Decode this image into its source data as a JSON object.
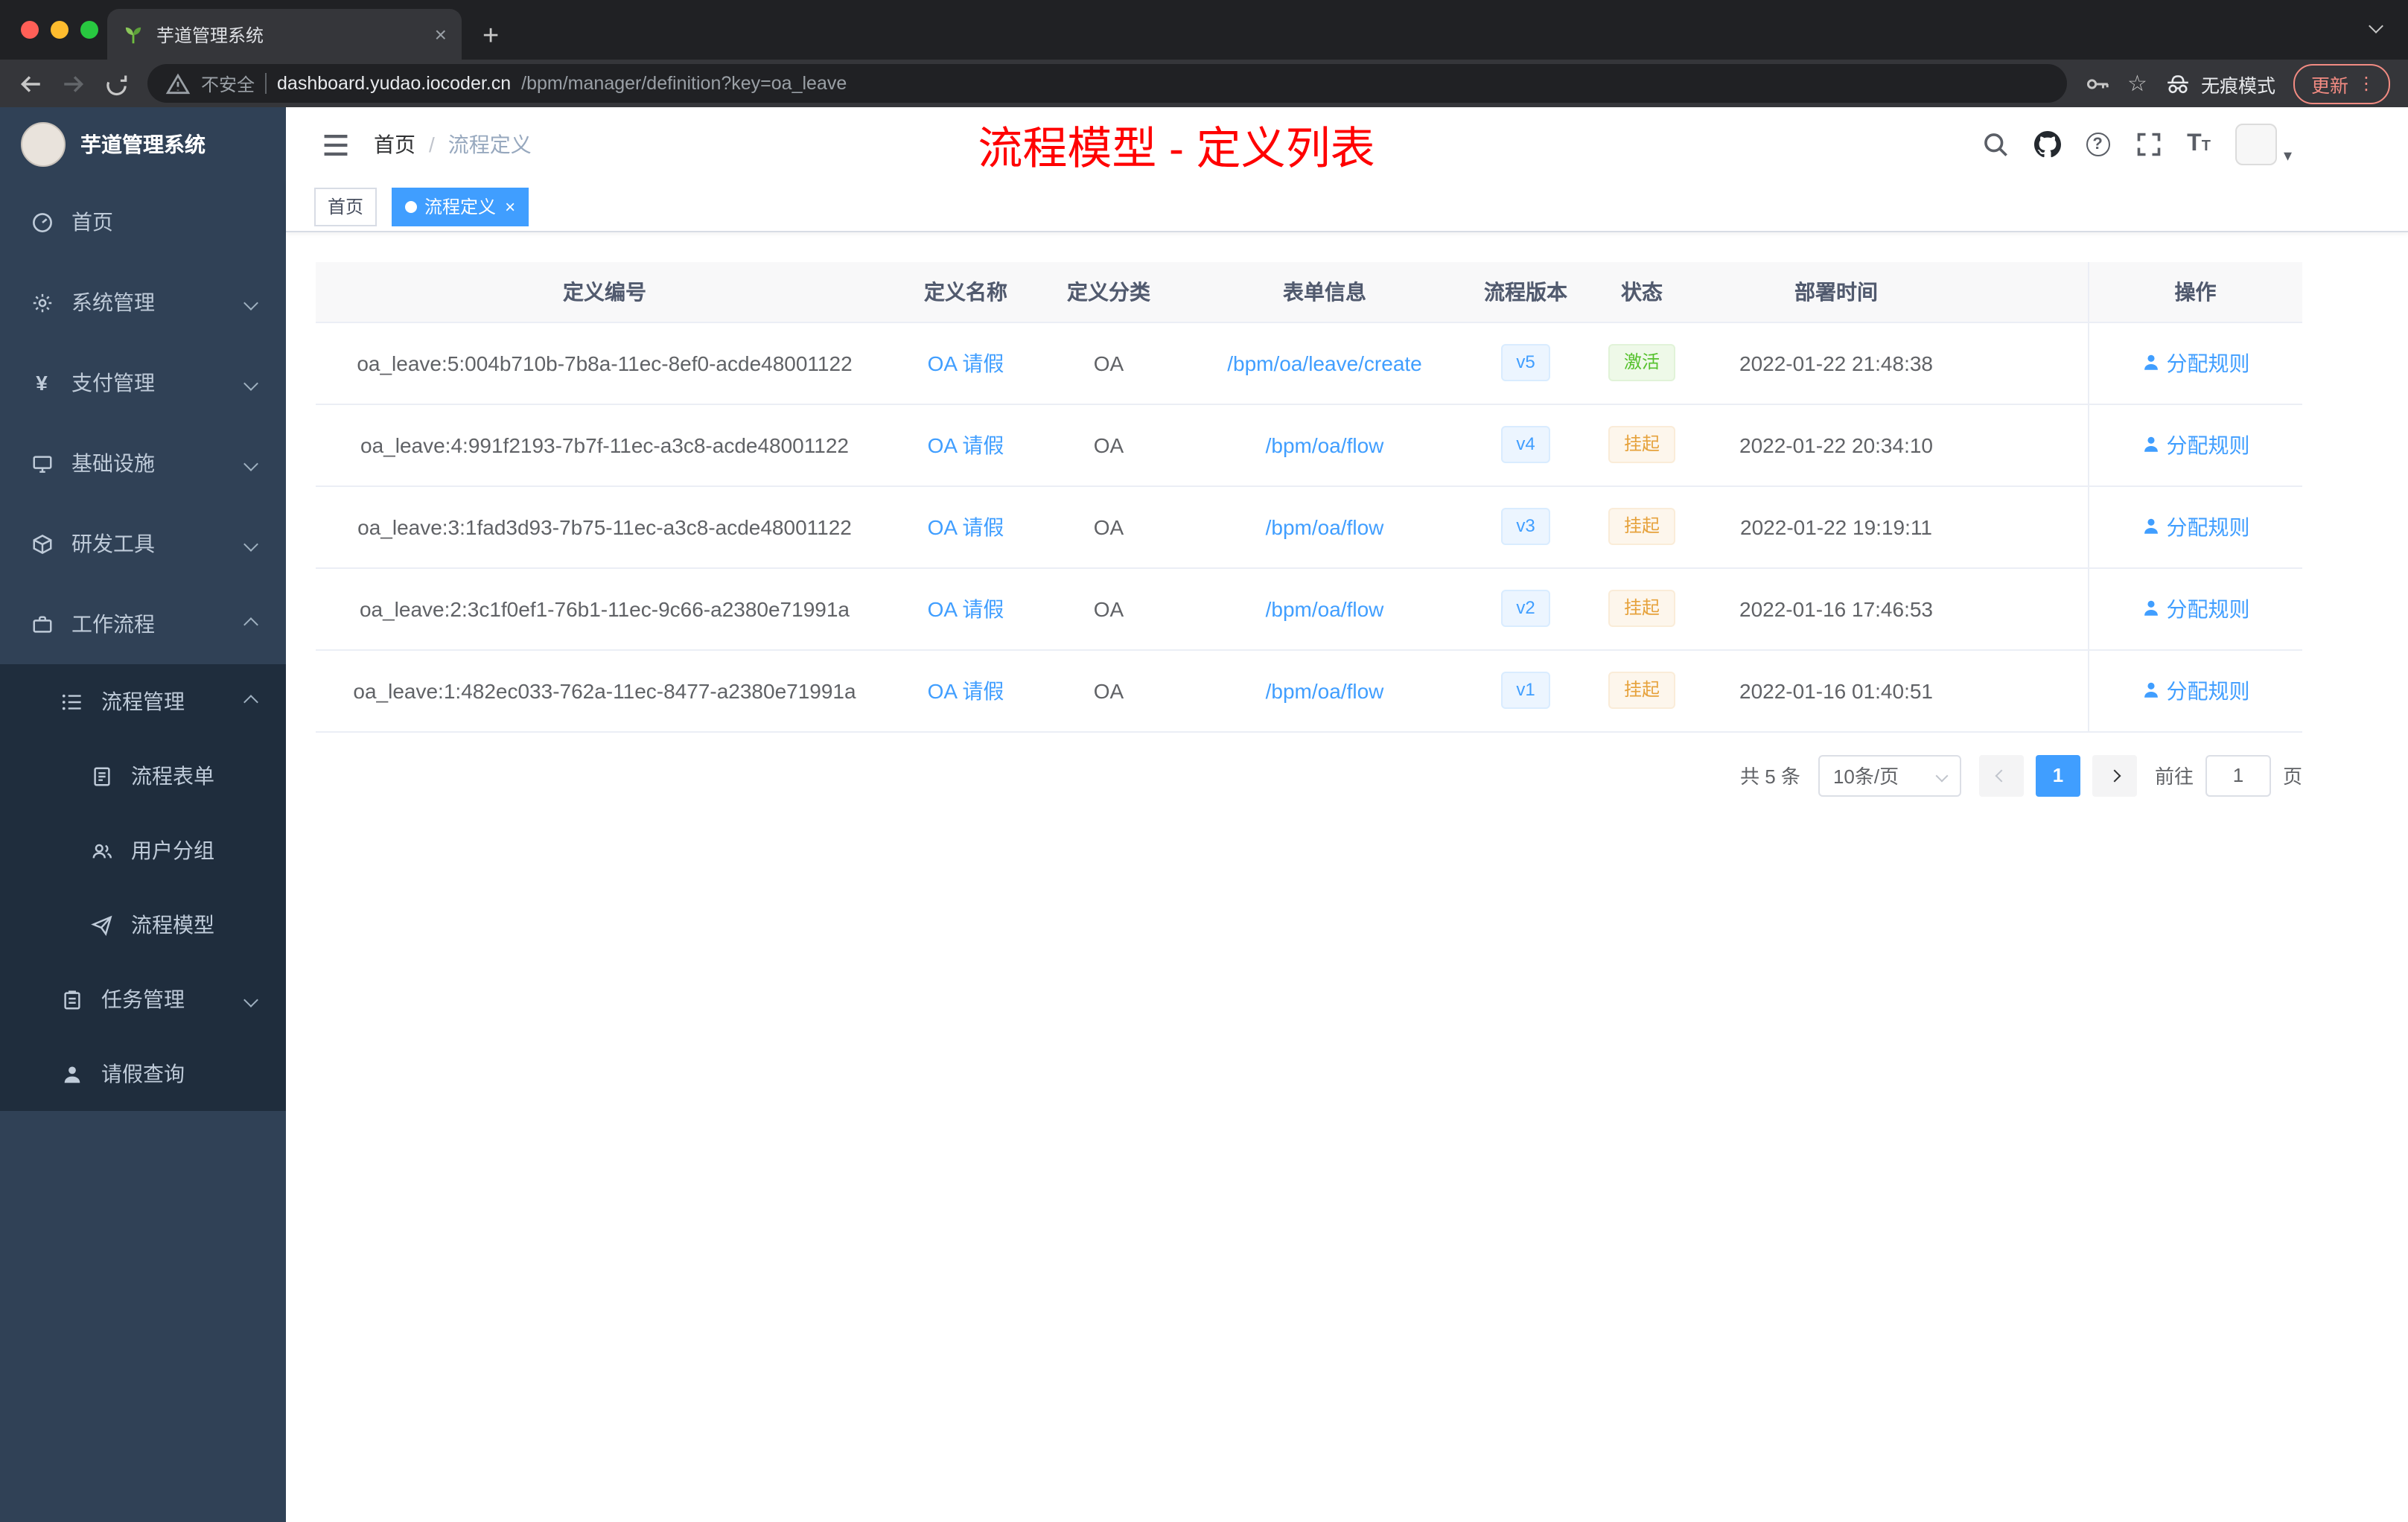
{
  "colors": {
    "accent": "#409eff",
    "title_red": "#ff0000",
    "status_active_green": "#55c12d",
    "status_suspend_orange": "#e6a23c",
    "sidebar_bg": "#304156",
    "sidebar_sub_bg": "#1f2d3d"
  },
  "browser": {
    "tab": {
      "title": "芋道管理系统"
    },
    "address": {
      "security_label": "不安全",
      "host": "dashboard.yudao.iocoder.cn",
      "path": "/bpm/manager/definition?key=oa_leave"
    },
    "incognito_label": "无痕模式",
    "update_label": "更新"
  },
  "sidebar": {
    "logo_title": "芋道管理系统",
    "items": [
      {
        "label": "首页"
      },
      {
        "label": "系统管理"
      },
      {
        "label": "支付管理"
      },
      {
        "label": "基础设施"
      },
      {
        "label": "研发工具"
      },
      {
        "label": "工作流程"
      },
      {
        "label": "流程管理"
      },
      {
        "label": "流程表单"
      },
      {
        "label": "用户分组"
      },
      {
        "label": "流程模型"
      },
      {
        "label": "任务管理"
      },
      {
        "label": "请假查询"
      }
    ]
  },
  "header": {
    "breadcrumb": {
      "home": "首页",
      "current": "流程定义"
    },
    "page_title": "流程模型 - 定义列表"
  },
  "tags": {
    "home": "首页",
    "active": "流程定义"
  },
  "table": {
    "columns": [
      "定义编号",
      "定义名称",
      "定义分类",
      "表单信息",
      "流程版本",
      "状态",
      "部署时间",
      "操作"
    ],
    "action_label": "分配规则",
    "rows": [
      {
        "id": "oa_leave:5:004b710b-7b8a-11ec-8ef0-acde48001122",
        "name": "OA 请假",
        "category": "OA",
        "form": "/bpm/oa/leave/create",
        "version": "v5",
        "status": "激活",
        "time": "2022-01-22 21:48:38"
      },
      {
        "id": "oa_leave:4:991f2193-7b7f-11ec-a3c8-acde48001122",
        "name": "OA 请假",
        "category": "OA",
        "form": "/bpm/oa/flow",
        "version": "v4",
        "status": "挂起",
        "time": "2022-01-22 20:34:10"
      },
      {
        "id": "oa_leave:3:1fad3d93-7b75-11ec-a3c8-acde48001122",
        "name": "OA 请假",
        "category": "OA",
        "form": "/bpm/oa/flow",
        "version": "v3",
        "status": "挂起",
        "time": "2022-01-22 19:19:11"
      },
      {
        "id": "oa_leave:2:3c1f0ef1-76b1-11ec-9c66-a2380e71991a",
        "name": "OA 请假",
        "category": "OA",
        "form": "/bpm/oa/flow",
        "version": "v2",
        "status": "挂起",
        "time": "2022-01-16 17:46:53"
      },
      {
        "id": "oa_leave:1:482ec033-762a-11ec-8477-a2380e71991a",
        "name": "OA 请假",
        "category": "OA",
        "form": "/bpm/oa/flow",
        "version": "v1",
        "status": "挂起",
        "time": "2022-01-16 01:40:51"
      }
    ]
  },
  "pagination": {
    "total": "共 5 条",
    "page_size": "10条/页",
    "current_page": "1",
    "goto_prefix": "前往",
    "goto_value": "1",
    "goto_suffix": "页"
  }
}
